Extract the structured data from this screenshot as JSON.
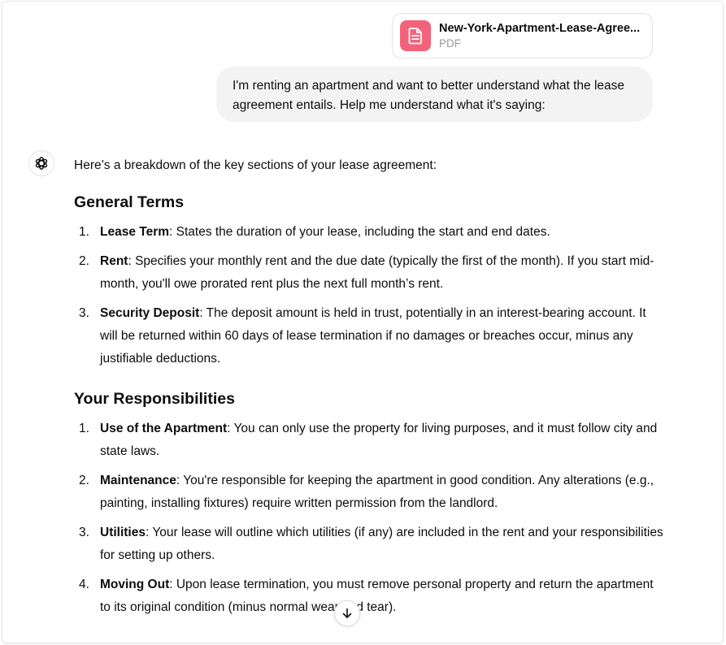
{
  "attachment": {
    "file_name": "New-York-Apartment-Lease-Agree...",
    "file_type": "PDF",
    "icon": "document-icon",
    "icon_color": "#f2637b"
  },
  "user_message": {
    "text": "I'm renting an apartment and want to better understand what the lease agreement entails. Help me understand what it's saying:"
  },
  "assistant": {
    "avatar_icon": "openai-logo-icon",
    "intro": "Here’s a breakdown of the key sections of your lease agreement:",
    "sections": [
      {
        "title": "General Terms",
        "items": [
          {
            "num": "1.",
            "term": "Lease Term",
            "text": ": States the duration of your lease, including the start and end dates."
          },
          {
            "num": "2.",
            "term": "Rent",
            "text": ": Specifies your monthly rent and the due date (typically the first of the month). If you start mid-month, you'll owe prorated rent plus the next full month’s rent."
          },
          {
            "num": "3.",
            "term": "Security Deposit",
            "text": ": The deposit amount is held in trust, potentially in an interest-bearing account. It will be returned within 60 days of lease termination if no damages or breaches occur, minus any justifiable deductions."
          }
        ]
      },
      {
        "title": "Your Responsibilities",
        "items": [
          {
            "num": "1.",
            "term": "Use of the Apartment",
            "text": ": You can only use the property for living purposes, and it must follow city and state laws."
          },
          {
            "num": "2.",
            "term": "Maintenance",
            "text": ": You're responsible for keeping the apartment in good condition. Any alterations (e.g., painting, installing fixtures) require written permission from the landlord."
          },
          {
            "num": "3.",
            "term": "Utilities",
            "text": ": Your lease will outline which utilities (if any) are included in the rent and your responsibilities for setting up others."
          },
          {
            "num": "4.",
            "term": "Moving Out",
            "text": ": Upon lease termination, you must remove personal property and return the apartment to its original condition (minus normal wear and tear)."
          }
        ]
      }
    ]
  },
  "scroll_button": {
    "icon": "arrow-down-icon"
  }
}
